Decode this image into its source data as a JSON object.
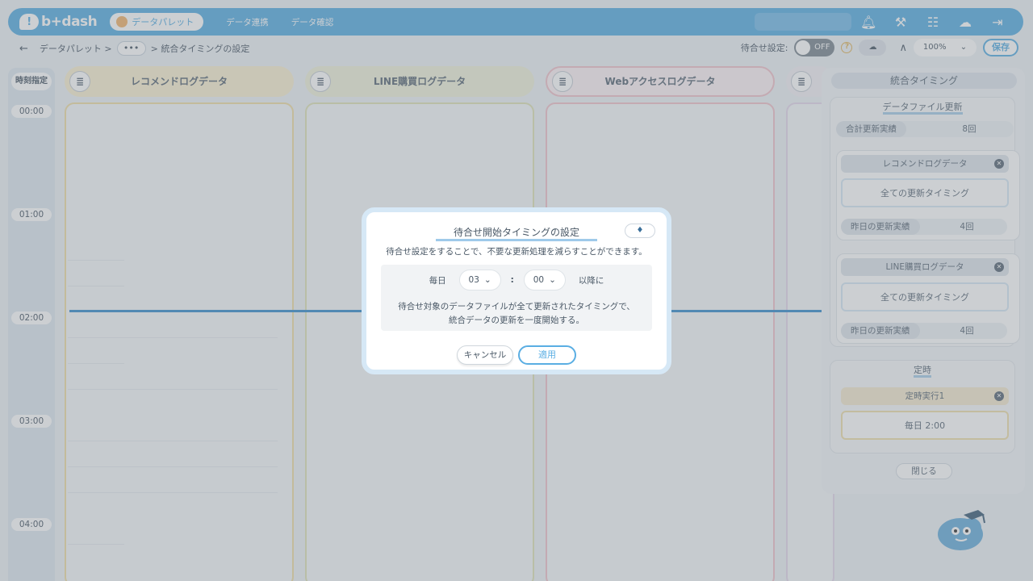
{
  "header": {
    "logo": "b+dash",
    "nav_active": "データパレット",
    "nav_links": [
      "データ連携",
      "データ確認"
    ]
  },
  "breadcrumb": {
    "back": "←",
    "item1": "データパレット >",
    "more": "•••",
    "item2": "> 統合タイミングの設定"
  },
  "controls": {
    "wait_label": "待合せ設定:",
    "toggle": "OFF",
    "help": "?",
    "zoom": "100%",
    "save": "保存"
  },
  "time_column": {
    "header": "時刻指定",
    "times": [
      "00:00",
      "01:00",
      "02:00",
      "03:00",
      "04:00"
    ]
  },
  "columns": [
    {
      "title": "レコメンドログデータ"
    },
    {
      "title": "LINE購買ログデータ"
    },
    {
      "title": "Webアクセスログデータ"
    }
  ],
  "panel": {
    "title": "統合タイミング",
    "section_file": "データファイル更新",
    "total_label": "合計更新実績",
    "total_value": "8回",
    "sources": [
      {
        "name": "レコメンドログデータ",
        "timing": "全ての更新タイミング",
        "yesterday_label": "昨日の更新実績",
        "yesterday_value": "4回"
      },
      {
        "name": "LINE購買ログデータ",
        "timing": "全ての更新タイミング",
        "yesterday_label": "昨日の更新実績",
        "yesterday_value": "4回"
      }
    ],
    "section_fixed": "定時",
    "fixed_name": "定時実行1",
    "fixed_timing": "毎日 2:00",
    "close": "閉じる"
  },
  "modal": {
    "title": "待合せ開始タイミングの設定",
    "description": "待合せ設定をすることで、不要な更新処理を減らすことができます。",
    "every_day": "毎日",
    "hour": "03",
    "colon": ":",
    "minute": "00",
    "after": "以降に",
    "note_line1": "待合せ対象のデータファイルが全て更新されたタイミングで、",
    "note_line2": "統合データの更新を一度開始する。",
    "cancel": "キャンセル",
    "apply": "適用"
  },
  "colors": {
    "brand": "#5aaee3",
    "col1_border": "#f0dfa6",
    "col2_border": "#e0e4b8",
    "col3_border": "#f2c4cc"
  }
}
